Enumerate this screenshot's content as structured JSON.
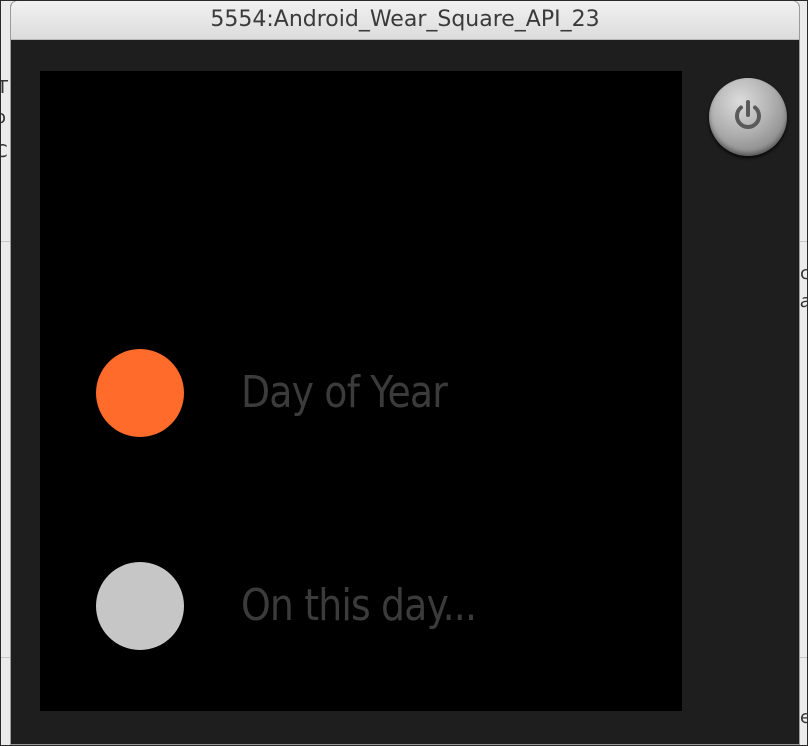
{
  "window": {
    "title": "5554:Android_Wear_Square_API_23"
  },
  "emulator": {
    "power_button_icon": "power-icon"
  },
  "list": {
    "items": [
      {
        "label": "Day of Year",
        "dot_color": "#ff6b2b",
        "selected": true
      },
      {
        "label": "On this day...",
        "dot_color": "#c6c6c6",
        "selected": false
      }
    ]
  },
  "background_fragments": {
    "left_1": "T",
    "left_2": "o",
    "left_3": "C",
    "right_1": "c",
    "right_2": "a",
    "right_3": "e"
  }
}
